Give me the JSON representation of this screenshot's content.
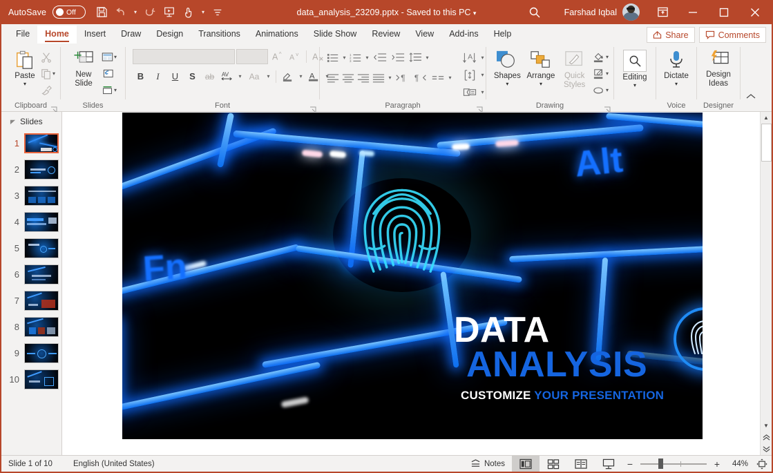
{
  "titlebar": {
    "autosave_label": "AutoSave",
    "autosave_state": "Off",
    "filename": "data_analysis_23209.pptx",
    "separator": "-",
    "save_state": "Saved to this PC",
    "username": "Farshad Iqbal",
    "quick_access": [
      {
        "name": "save-icon",
        "label": "Save"
      },
      {
        "name": "undo-icon",
        "label": "Undo"
      },
      {
        "name": "redo-icon",
        "label": "Redo"
      },
      {
        "name": "start-from-beginning-icon",
        "label": "Start From Beginning"
      },
      {
        "name": "touch-mode-icon",
        "label": "Touch/Mouse Mode"
      },
      {
        "name": "customize-qat-icon",
        "label": "Customize Quick Access Toolbar"
      }
    ],
    "window_buttons": [
      "Ribbon Display Options",
      "Minimize",
      "Restore",
      "Close"
    ]
  },
  "tabs": [
    {
      "label": "File",
      "active": false
    },
    {
      "label": "Home",
      "active": true
    },
    {
      "label": "Insert",
      "active": false
    },
    {
      "label": "Draw",
      "active": false
    },
    {
      "label": "Design",
      "active": false
    },
    {
      "label": "Transitions",
      "active": false
    },
    {
      "label": "Animations",
      "active": false
    },
    {
      "label": "Slide Show",
      "active": false
    },
    {
      "label": "Review",
      "active": false
    },
    {
      "label": "View",
      "active": false
    },
    {
      "label": "Add-ins",
      "active": false
    },
    {
      "label": "Help",
      "active": false
    }
  ],
  "tab_actions": {
    "share": "Share",
    "comments": "Comments"
  },
  "ribbon": {
    "groups": [
      {
        "name": "clipboard",
        "label": "Clipboard"
      },
      {
        "name": "slides",
        "label": "Slides"
      },
      {
        "name": "font",
        "label": "Font"
      },
      {
        "name": "paragraph",
        "label": "Paragraph"
      },
      {
        "name": "drawing",
        "label": "Drawing"
      },
      {
        "name": "editing",
        "label": "Editing"
      },
      {
        "name": "voice",
        "label": "Voice"
      },
      {
        "name": "designer",
        "label": "Designer"
      }
    ],
    "clipboard": {
      "paste": "Paste",
      "cut": "Cut",
      "copy": "Copy",
      "format_painter": "Format Painter"
    },
    "slides": {
      "new_slide": "New Slide",
      "layout": "Layout",
      "reset": "Reset",
      "section": "Section"
    },
    "font": {
      "font_name_value": "",
      "font_name_placeholder": "",
      "font_size_value": "",
      "font_size_placeholder": "",
      "grow": "Increase Font Size",
      "shrink": "Decrease Font Size",
      "clear": "Clear All Formatting",
      "bold": "B",
      "italic": "I",
      "underline": "U",
      "shadow": "S",
      "strikethrough": "ab",
      "spacing": "AV",
      "case": "Aa",
      "highlight": "Text Highlight Color",
      "fontcolor": "Font Color"
    },
    "drawing": {
      "shapes": "Shapes",
      "arrange": "Arrange",
      "quick_styles": "Quick Styles",
      "shape_fill": "Shape Fill",
      "shape_outline": "Shape Outline",
      "shape_effects": "Shape Effects"
    },
    "editing": {
      "label": "Editing"
    },
    "voice": {
      "dictate": "Dictate"
    },
    "designer": {
      "design_ideas": "Design Ideas"
    }
  },
  "thumbnails": {
    "header": "Slides",
    "items": [
      {
        "number": "1",
        "selected": true
      },
      {
        "number": "2",
        "selected": false
      },
      {
        "number": "3",
        "selected": false
      },
      {
        "number": "4",
        "selected": false
      },
      {
        "number": "5",
        "selected": false
      },
      {
        "number": "6",
        "selected": false
      },
      {
        "number": "7",
        "selected": false
      },
      {
        "number": "8",
        "selected": false
      },
      {
        "number": "9",
        "selected": false
      },
      {
        "number": "10",
        "selected": false
      }
    ]
  },
  "slide": {
    "title_white": "DATA",
    "title_blue": "ANALYSIS",
    "subtitle_white": "CUSTOMIZE",
    "subtitle_blue": "YOUR PRESENTATION",
    "keycap_fn": "Fn",
    "keycap_alt": "Alt",
    "colors": {
      "accent_blue": "#1565e0",
      "glow_blue": "#1f8bf5",
      "background": "#000000"
    }
  },
  "status": {
    "slide_counter": "Slide 1 of 10",
    "language": "English (United States)",
    "notes": "Notes",
    "views": [
      {
        "name": "normal-view",
        "active": true
      },
      {
        "name": "slide-sorter-view",
        "active": false
      },
      {
        "name": "reading-view",
        "active": false
      },
      {
        "name": "slide-show-view",
        "active": false
      }
    ],
    "zoom_out": "−",
    "zoom_in": "+",
    "zoom_value": "44%",
    "fit_label": "Fit slide to current window"
  }
}
